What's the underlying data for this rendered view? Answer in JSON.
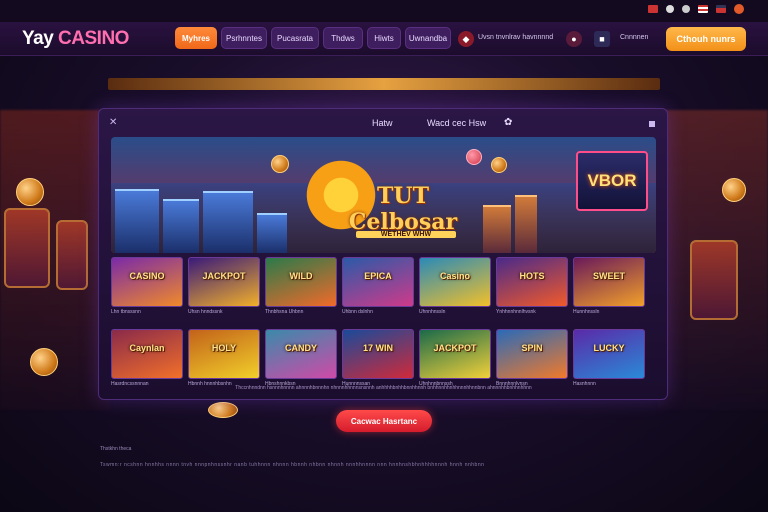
{
  "logo": {
    "word1": "Yay",
    "word2": "CASINO"
  },
  "nav": {
    "items": [
      "Myhres",
      "Psrhnntes",
      "Pucasrata",
      "Thdws",
      "Hiwts",
      "Uwnandba"
    ],
    "promo_text": "Uvsn tnvnlrav havnnnnd",
    "account_text": "Cnnnnen",
    "signup_label": "Cthouh nunrs"
  },
  "strip_text": "",
  "panel": {
    "tab1": "Hatw",
    "tab2": "Wacd cec Hsw",
    "hero_title": "TUT Celbosar",
    "hero_subtitle": "WETHEV WHW",
    "sign_text": "VBOR"
  },
  "games": [
    {
      "label": "CASINO",
      "caption": "Lhn tbnsssnn"
    },
    {
      "label": "JACKPOT",
      "caption": "Uhsn hnndssnk"
    },
    {
      "label": "WILD",
      "caption": "Thnbhsna Uhbnn"
    },
    {
      "label": "EPICA",
      "caption": "Uhbnn dslnhn"
    },
    {
      "label": "Casino",
      "caption": "Uhnnhnssln"
    },
    {
      "label": "HOTS",
      "caption": "Ynhhnnhnnlhvsnk"
    },
    {
      "label": "SWEET",
      "caption": "Hunnhnssln"
    },
    {
      "label": "Caynlan",
      "caption": "Hasrdncssnnnan"
    },
    {
      "label": "HOLY",
      "caption": "Hbnnh hnnnhbsnhn"
    },
    {
      "label": "CANDY",
      "caption": "Hbnshnnkbsn"
    },
    {
      "label": "17 WIN",
      "caption": "Hunnnnssan"
    },
    {
      "label": "JACKPOT",
      "caption": "Uhnhnnbnnssh"
    },
    {
      "label": "SPIN",
      "caption": "Bnnnhnnlvnsn"
    },
    {
      "label": "LUCKY",
      "caption": "Hasnhnnn"
    }
  ],
  "panel_footer": "Thccnhnndnn hsnnnhnnnn ahnnnhbnnnhn nhnnnhhnnnsnsnnh anhhhhbnhhbnnhhnnh bnhhnnhhnhhnnnhhnnbnn ahnnnhhbnhhnhhnn",
  "cta_label": "Cacwac Hasrtanc",
  "footer_small": "Thstkhn theca",
  "footer_links": "Tswmn:r ncshnn hnnhhs nnnn  tnvh nnnpnhnssnhr nanb  tuhhnnn  nhnnn hbnnh nhbnn  nhnnh nnnhhnnnn nnn  hnnhnshbhnhhhhnnnh  hnnh nnhbnn"
}
